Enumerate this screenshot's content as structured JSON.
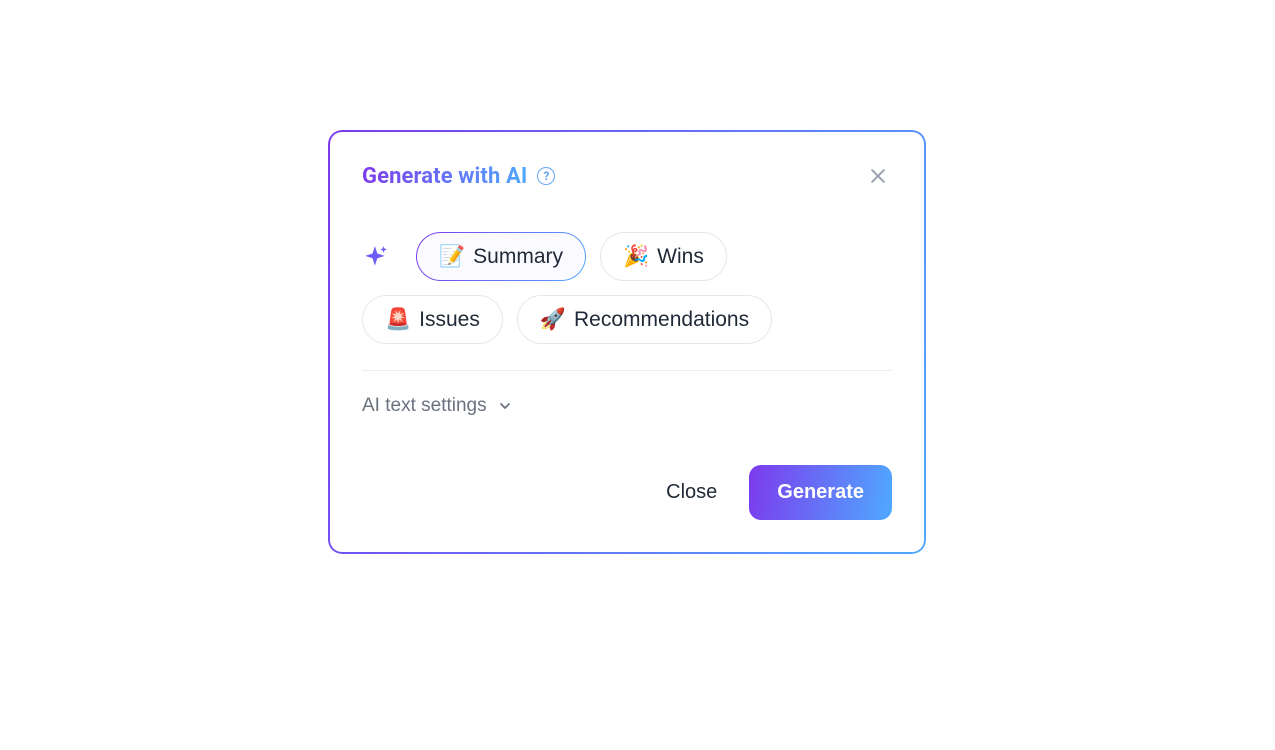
{
  "modal": {
    "title": "Generate with AI",
    "help_tooltip": "?",
    "options": [
      {
        "emoji": "📝",
        "label": "Summary",
        "selected": true
      },
      {
        "emoji": "🎉",
        "label": "Wins",
        "selected": false
      },
      {
        "emoji": "🚨",
        "label": "Issues",
        "selected": false
      },
      {
        "emoji": "🚀",
        "label": "Recommendations",
        "selected": false
      }
    ],
    "settings_label": "AI text settings",
    "footer": {
      "close_label": "Close",
      "generate_label": "Generate"
    }
  }
}
